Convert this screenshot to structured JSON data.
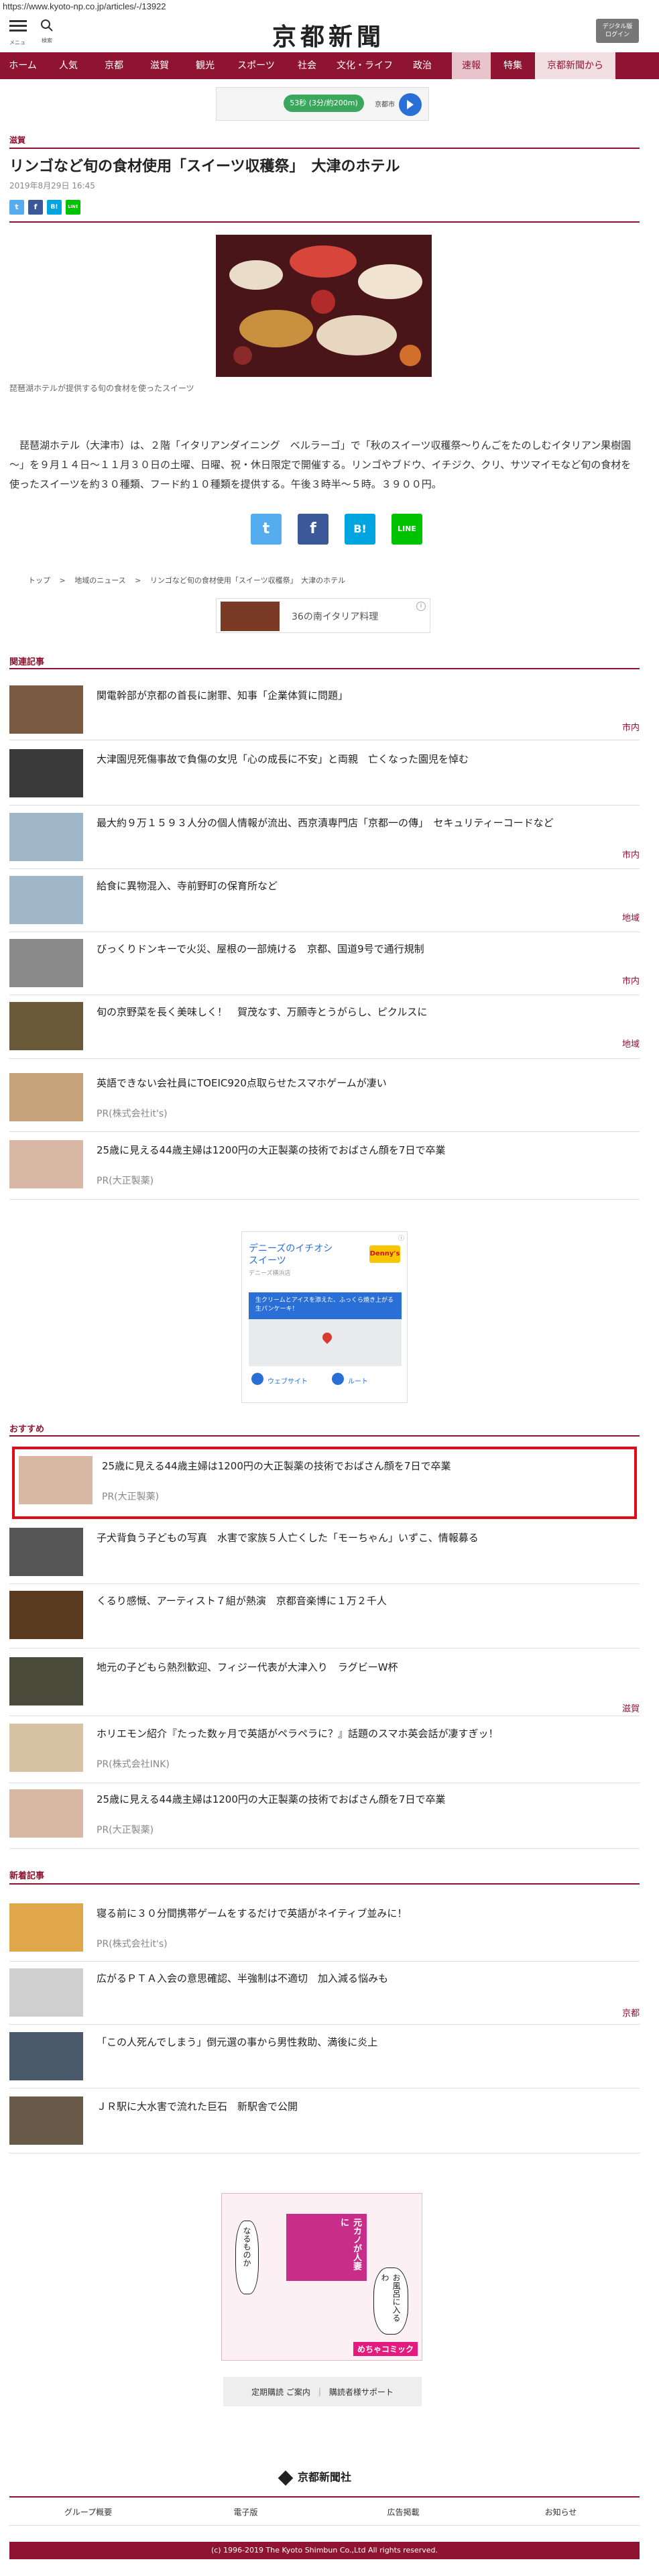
{
  "url": "https://www.kyoto-np.co.jp/articles/-/13922",
  "header": {
    "menu_label": "メニュー",
    "search_label": "検索",
    "logo": "京都新聞",
    "digital_line1": "デジタル版",
    "digital_line2": "ログイン"
  },
  "nav": {
    "items": [
      "ホーム",
      "人気",
      "京都",
      "滋賀",
      "観光",
      "スポーツ",
      "社会",
      "文化・ライフ",
      "政治",
      "速報",
      "特集",
      "京都新聞から"
    ]
  },
  "map_ad": {
    "route_label": "53秒 (3分/約200m)",
    "destination": "京都市"
  },
  "article": {
    "category": "滋賀",
    "title": "リンゴなど旬の食材使用「スイーツ収穫祭」　大津のホテル",
    "date": "2019年8月29日 16:45",
    "caption": "琵琶湖ホテルが提供する旬の食材を使ったスイーツ",
    "body": "　琵琶湖ホテル（大津市）は、２階「イタリアンダイニング　ベルラーゴ」で「秋のスイーツ収穫祭～りんごをたのしむイタリアン果樹園～」を９月１４日～１１月３０日の土曜、日曜、祝・休日限定で開催する。リンゴやブドウ、イチジク、クリ、サツマイモなど旬の食材を使ったスイーツを約３０種類、フード約１０種類を提供する。午後３時半～５時。３９００円。"
  },
  "share": {
    "twitter": "t",
    "facebook": "f",
    "hatena": "B!",
    "line": "LINE"
  },
  "breadcrumb": [
    "トップ",
    ">",
    "地域のニュース",
    ">",
    "リンゴなど旬の食材使用「スイーツ収穫祭」　大津のホテル"
  ],
  "rich_ad": {
    "text": "36の南イタリア料理",
    "info": "i"
  },
  "related": {
    "heading": "関連記事",
    "items": [
      {
        "title": "関電幹部が京都の首長に謝罪、知事「企業体質に問題」",
        "tag": "市内",
        "pr": ""
      },
      {
        "title": "大津園児死傷事故で負傷の女児「心の成長に不安」と両親　亡くなった園児を悼む",
        "tag": "",
        "pr": ""
      },
      {
        "title": "最大約９万１５９３人分の個人情報が流出、西京漬専門店「京都一の傳」　セキュリティーコードなど",
        "tag": "市内",
        "pr": ""
      },
      {
        "title": "給食に異物混入、寺前野町の保育所など",
        "tag": "地域",
        "pr": ""
      },
      {
        "title": "びっくりドンキーで火災、屋根の一部焼ける　京都、国道9号で通行規制",
        "tag": "市内",
        "pr": ""
      },
      {
        "title": "旬の京野菜を長く美味しく！　賀茂なす、万願寺とうがらし、ピクルスに",
        "tag": "地域",
        "pr": ""
      },
      {
        "title": "英語できない会社員にTOEIC920点取らせたスマホゲームが凄い",
        "tag": "",
        "pr": "PR(株式会社it's)"
      },
      {
        "title": "25歳に見える44歳主婦は1200円の大正製薬の技術でおばさん顔を7日で卒業",
        "tag": "",
        "pr": "PR(大正製薬)"
      }
    ]
  },
  "denny_ad": {
    "title_line1": "デニーズのイチオシ",
    "title_line2": "スイーツ",
    "sub": "デニーズ横浜店",
    "logo": "Denny's",
    "blue_text": "生クリームとアイスを添えた、ふっくら焼き上がる生パンケーキ！",
    "website": "ウェブサイト",
    "route": "ルート"
  },
  "recommended": {
    "heading": "おすすめ",
    "items": [
      {
        "title": "25歳に見える44歳主婦は1200円の大正製薬の技術でおばさん顔を7日で卒業",
        "tag": "",
        "pr": "PR(大正製薬)"
      },
      {
        "title": "子犬背負う子どもの写真　水害で家族５人亡くした「モーちゃん」いずこ、情報募る",
        "tag": "",
        "pr": ""
      },
      {
        "title": "くるり感慨、アーティスト７組が熱演　京都音楽博に１万２千人",
        "tag": "",
        "pr": ""
      },
      {
        "title": "地元の子どもら熱烈歓迎、フィジー代表が大津入り　ラグビーW杯",
        "tag": "滋賀",
        "pr": ""
      },
      {
        "title": "ホリエモン紹介『たった数ヶ月で英語がペラペラに？』話題のスマホ英会話が凄すぎッ！",
        "tag": "",
        "pr": "PR(株式会社INK)"
      },
      {
        "title": "25歳に見える44歳主婦は1200円の大正製薬の技術でおばさん顔を7日で卒業",
        "tag": "",
        "pr": "PR(大正製薬)"
      }
    ]
  },
  "latest": {
    "heading": "新着記事",
    "items": [
      {
        "title": "寝る前に３０分間携帯ゲームをするだけで英語がネイティブ並みに！",
        "tag": "",
        "pr": "PR(株式会社it's)"
      },
      {
        "title": "広がるＰＴＡ入会の意思確認、半強制は不適切　加入減る悩みも",
        "tag": "京都",
        "pr": ""
      },
      {
        "title": "「この人死んでしまう」倒元選の事から男性救助、満後に炎上",
        "tag": "",
        "pr": ""
      },
      {
        "title": "ＪＲ駅に大水害で流れた巨石　新駅舎で公開",
        "tag": "",
        "pr": ""
      }
    ]
  },
  "manga_ad": {
    "bubble1": "なるものか",
    "bubble2": "お風呂に入るわ",
    "banner": "元カノが人妻に",
    "brand": "めちゃコミック"
  },
  "sub_links": {
    "left": "定期購読 ご案内",
    "sep": "|",
    "right": "購読者様サポート"
  },
  "footer": {
    "logo": "京都新聞社",
    "links": [
      "グループ概要",
      "電子版",
      "広告掲載",
      "お知らせ"
    ],
    "copyright": "(c) 1996-2019 The Kyoto Shimbun Co.,Ltd All rights reserved."
  },
  "colors": {
    "brand": "#8e1431",
    "twitter": "#55acee",
    "facebook": "#3b5998",
    "hatena": "#00a4de",
    "line": "#00c300",
    "highlight": "#e20a17"
  }
}
